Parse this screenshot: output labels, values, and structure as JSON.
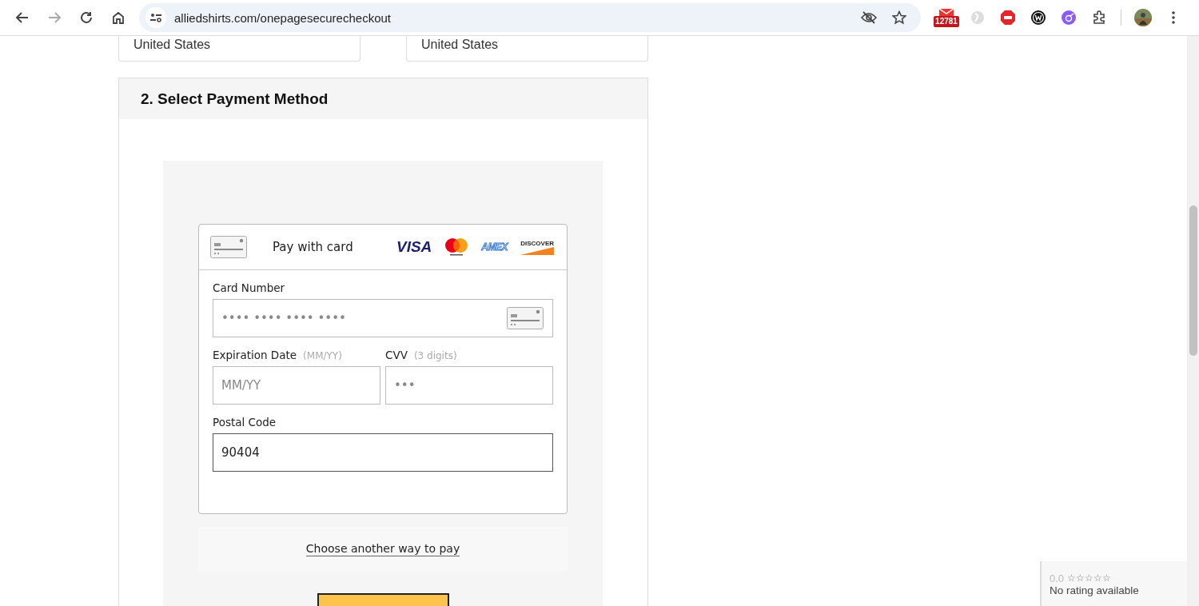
{
  "browser": {
    "url": "alliedshirts.com/onepagesecurecheckout",
    "mail_badge": "12781"
  },
  "address_cards": [
    {
      "country": "United States"
    },
    {
      "country": "United States"
    }
  ],
  "payment": {
    "title": "2. Select Payment Method",
    "card_header": "Pay with card",
    "brands": [
      {
        "kind": "visa",
        "label": "VISA"
      },
      {
        "kind": "mastercard"
      },
      {
        "kind": "amex",
        "label": "AMEX"
      },
      {
        "kind": "discover",
        "label": "DISCOVER"
      }
    ],
    "card_number": {
      "label": "Card Number",
      "placeholder": "•••• •••• •••• ••••"
    },
    "expiration": {
      "label": "Expiration Date",
      "hint": "(MM/YY)",
      "placeholder": "MM/YY"
    },
    "cvv": {
      "label": "CVV",
      "hint": "(3 digits)",
      "placeholder": "•••"
    },
    "postal": {
      "label": "Postal Code",
      "value": "90404"
    },
    "other_way_link": "Choose another way to pay"
  },
  "rating_widget": {
    "score": "0.0",
    "stars": 0,
    "text": "No rating available"
  }
}
